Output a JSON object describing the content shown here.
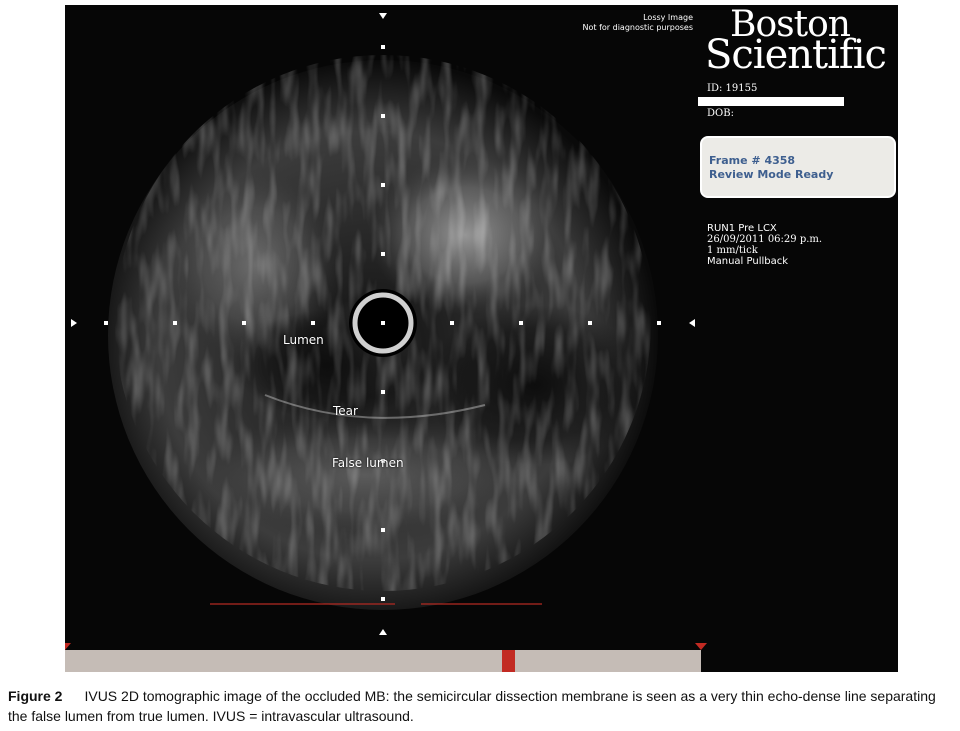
{
  "image": {
    "lossy_line1": "Lossy Image",
    "lossy_line2": "Not for diagnostic purposes",
    "brand_line1": "Boston",
    "brand_line2": "Scientific",
    "patient_id": "ID: 19155",
    "dob_label": "DOB:",
    "frame_label": "Frame # 4358",
    "mode_label": "Review Mode Ready",
    "run_info": [
      "RUN1 Pre LCX",
      "26/09/2011 06:29 p.m.",
      "1 mm/tick",
      "Manual Pullback"
    ],
    "annotations": {
      "lumen": "Lumen",
      "tear": "Tear",
      "false_lumen": "False lumen"
    },
    "colors": {
      "status_text": "#3e5f8f",
      "pullback_bar": "#c5bcb6",
      "marker_red": "#c22a22"
    }
  },
  "caption": {
    "label": "Figure 2",
    "text": "IVUS 2D tomographic image of the occluded MB: the semicircular dissection membrane is seen as a very thin echo-dense line separating the false lumen from true lumen. IVUS = intravascular ultrasound."
  }
}
